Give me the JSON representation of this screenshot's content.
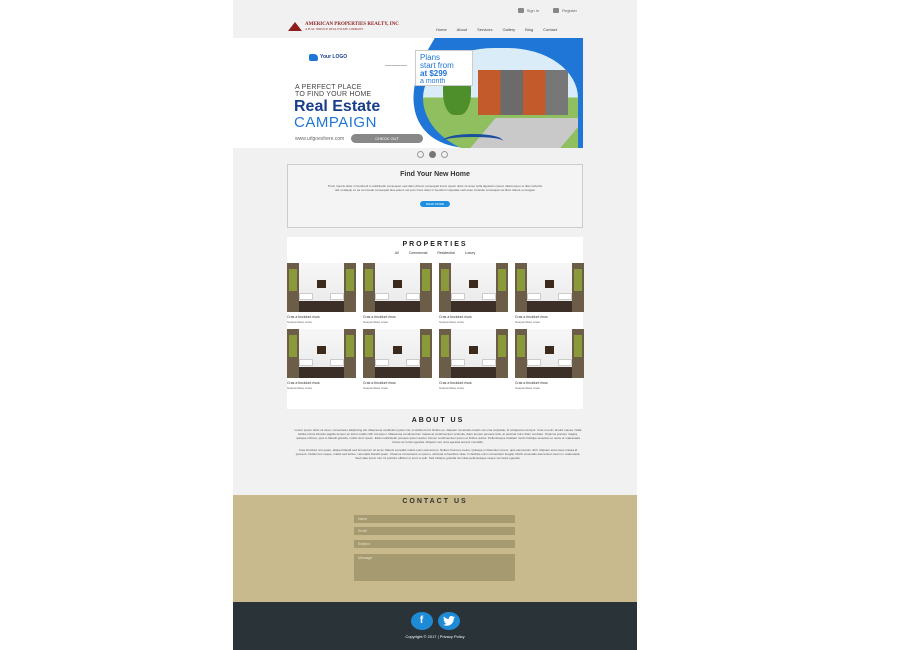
{
  "top_links": {
    "signin": "Sign In",
    "register": "Register"
  },
  "brand": {
    "name": "AMERICAN PROPERTIES REALTY, INC",
    "tagline": "A FULL SERVICE REAL ESTATE COMPANY"
  },
  "nav": [
    "Home",
    "About",
    "Services",
    "Gallery",
    "Blog",
    "Contact"
  ],
  "hero": {
    "logo_text": "Your LOGO",
    "badge": [
      "Plans",
      "start from",
      "at $299",
      "a month"
    ],
    "sub1": "A PERFECT PLACE",
    "sub2": "TO FIND YOUR HOME",
    "title1": "Real Estate",
    "title2": "CAMPAIGN",
    "url": "www.urlgoeshere.com",
    "cta": "CHECK OUT"
  },
  "find": {
    "title": "Find Your New Home",
    "body": "Proin mauris dolor in hendrerit in sollicitudin consequat, sed diam dictum consequat lorem ipsum dolor sit amet nulla dignissim ipsum ullamcorper et diam lobortis nisl ut aliquip ex ea commodo consequat duis autem vel eum iriure dolor in hendrerit vulputate velit esse molestie consequat vel illum dolore eu feugiat.",
    "button": "READ MORE"
  },
  "properties": {
    "title": "PROPERTIES",
    "filters": [
      "All",
      "Commercial",
      "Residential",
      "Luxury"
    ],
    "items": [
      {
        "title": "Cras a tincidunt risus",
        "sub": "Suspendisse scele"
      },
      {
        "title": "Cras a tincidunt risus",
        "sub": "Suspendisse scele"
      },
      {
        "title": "Cras a tincidunt risus",
        "sub": "Suspendisse scele"
      },
      {
        "title": "Cras a tincidunt risus",
        "sub": "Suspendisse scele"
      },
      {
        "title": "Cras a tincidunt risus",
        "sub": "Suspendisse scele"
      },
      {
        "title": "Cras a tincidunt risus",
        "sub": "Suspendisse scele"
      },
      {
        "title": "Cras a tincidunt risus",
        "sub": "Suspendisse scele"
      },
      {
        "title": "Cras a tincidunt risus",
        "sub": "Suspendisse scele"
      }
    ]
  },
  "about": {
    "title": "ABOUT US",
    "p1": "Lorem ipsum dolor sit amet, consectetur adipiscing elit. Maecenas vestibulum justo nisi, ut eleifend orci finibus eu. Aliquam venenatis mauris vel urna vulputate, id volutpat leo tempor. Cras ut enim iaculis massa. Nulla facilisi primis lobortis sagittis tempor ac tortor mattis nibh vel ipsum. Maecenas condimentum massa at condimentum vehicula, diam tempor posuere felis, at pulvinar nunc diam vel diam. Vivamus pretium magna, quisque ultrices, quis in blandit gravida, mollis nunc ipsum. Etiam sollicitudin posuere ipsum auctor. Donec condimentum ipsum et finibus auctor. Pellentesque habitant morbi tristique senectus et netus et malesuada fames ac turpis egestas. Aliquam nec urna egestas tempor convallis.",
    "p2": "Cras tincidunt orci quam, aliquet blandit sed fermentum sit amet. Mauris convallis mattis enim elementum. Nullam rhoncus metus. Quisque in bibendum lorem, quis elementum nibh. Aliquam accumsan massa id posuere. Nullam leo neque, mattis sed lectus, venenatis blandit quam. Vivamus consectetur ex ipsum, vehicula ut faucibus vitae. In facilisis enim consectetur feugiat. Morbi venenatis elementum lorem in malesuada. Sed vitae lorem nisl. Ut porttitor efficitur ut enim a velit. Sed tristique gravida nisi vitae pellentesque neque vel turpis egestas."
  },
  "contact": {
    "title": "CONTACT US",
    "name_ph": "Name",
    "email_ph": "Email",
    "subject_ph": "Subject",
    "message_ph": "Message"
  },
  "footer": {
    "facebook": "f",
    "twitter": "t",
    "copyright": "Copyright © 2017 | Privacy Policy"
  }
}
